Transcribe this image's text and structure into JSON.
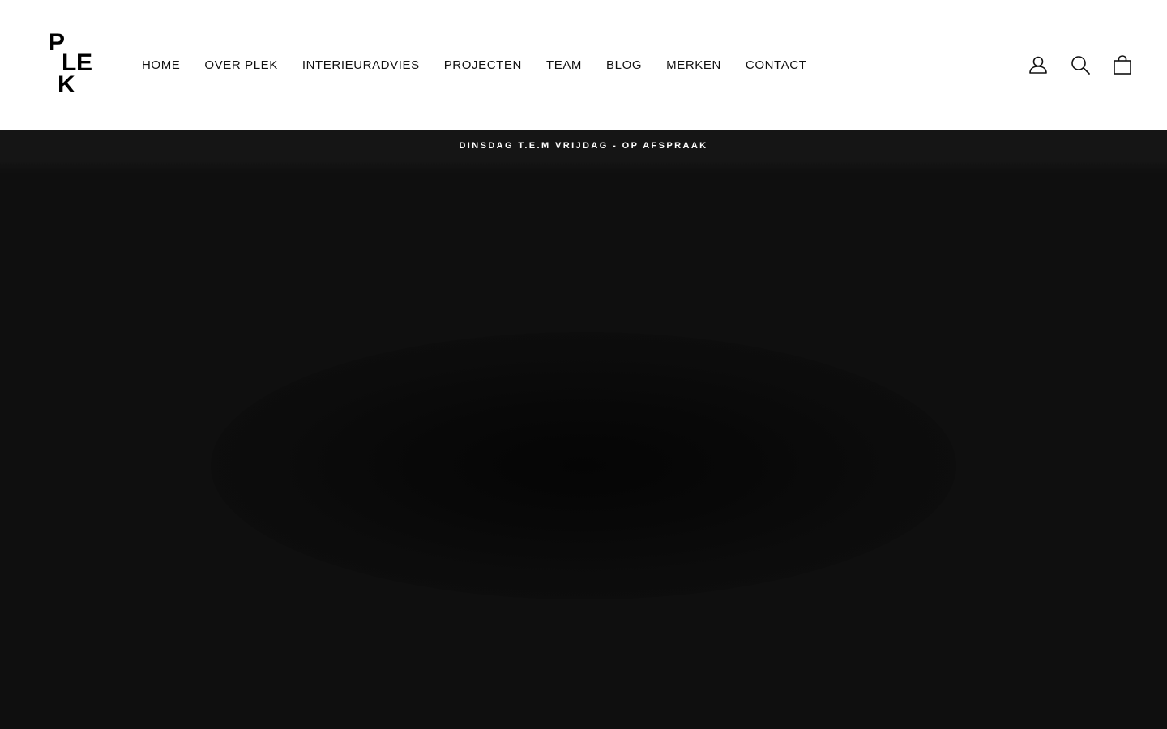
{
  "brand": {
    "logo_letters": [
      "P",
      "L",
      "E",
      "K"
    ]
  },
  "nav": {
    "items": [
      {
        "label": "HOME"
      },
      {
        "label": "OVER PLEK"
      },
      {
        "label": "INTERIEURADVIES"
      },
      {
        "label": "PROJECTEN"
      },
      {
        "label": "TEAM"
      },
      {
        "label": "BLOG"
      },
      {
        "label": "MERKEN"
      },
      {
        "label": "CONTACT"
      }
    ]
  },
  "header_icons": {
    "account": "user-icon",
    "search": "search-icon",
    "cart": "bag-icon"
  },
  "announcement": {
    "text": "DINSDAG T.E.M VRIJDAG - OP AFSPRAAK"
  },
  "colors": {
    "header_bg": "#ffffff",
    "announcement_bg": "#151515",
    "hero_bg": "#0f0f0f",
    "text_dark": "#111111",
    "text_light": "#ffffff"
  }
}
